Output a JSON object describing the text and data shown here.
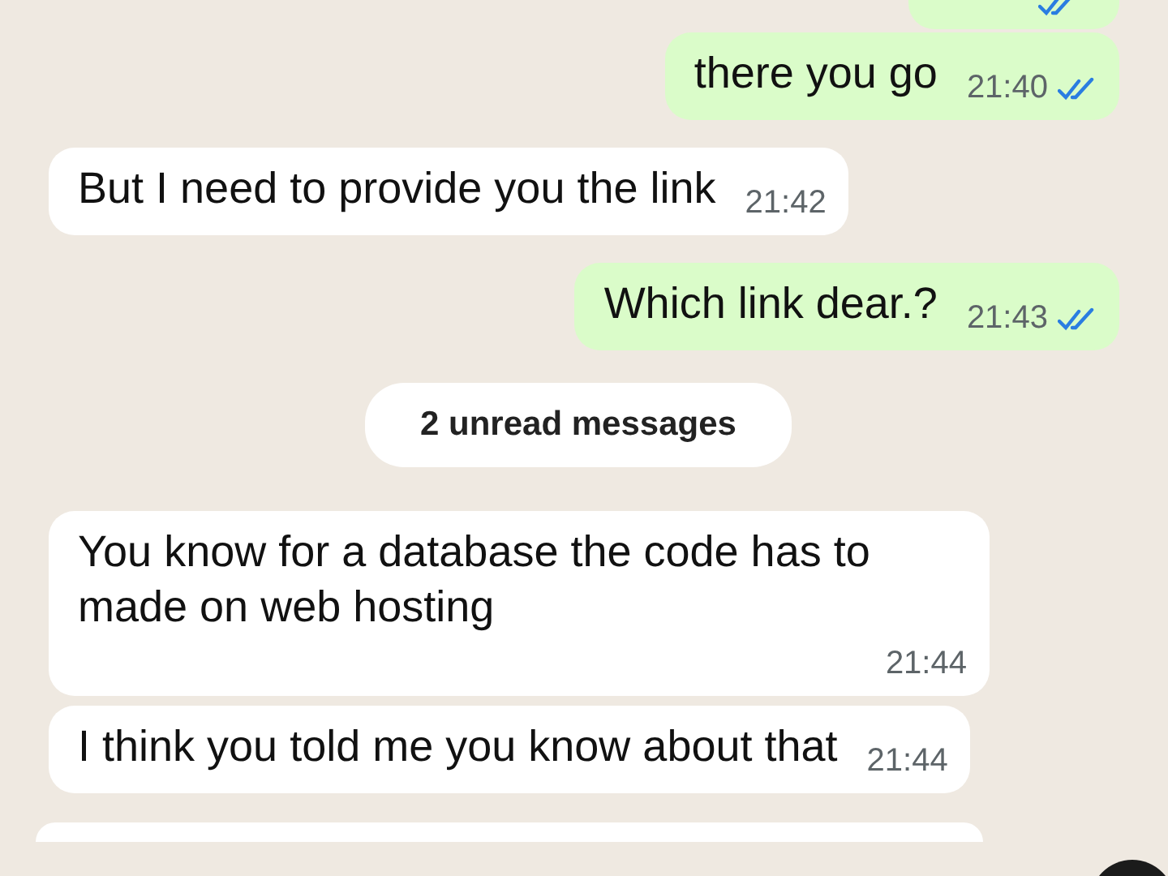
{
  "top_partial": {
    "kind": "outgoing",
    "read": true
  },
  "messages": [
    {
      "kind": "outgoing",
      "text": "there you go",
      "time": "21:40",
      "read": true
    },
    {
      "kind": "incoming",
      "text": "But I need to provide you the link",
      "time": "21:42"
    },
    {
      "kind": "outgoing",
      "text": "Which link dear.?",
      "time": "21:43",
      "read": true
    },
    {
      "kind": "divider",
      "text": "2 unread messages"
    },
    {
      "kind": "incoming",
      "text": "You know for a database the code has to made on web hosting",
      "time": "21:44"
    },
    {
      "kind": "incoming",
      "text": "I think you told me you know about that",
      "time": "21:44"
    }
  ],
  "bottom_partial": {
    "kind": "incoming"
  }
}
